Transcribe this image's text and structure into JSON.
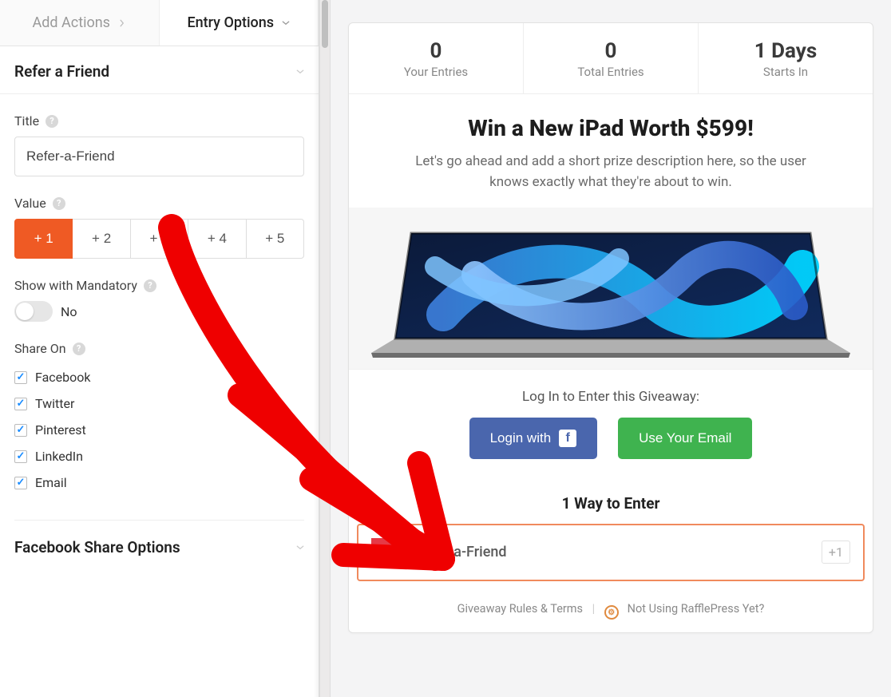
{
  "tabs": {
    "add_actions": "Add Actions",
    "entry_options": "Entry Options"
  },
  "accordion": {
    "refer_friend": "Refer a Friend",
    "facebook_share": "Facebook Share Options"
  },
  "fields": {
    "title_label": "Title",
    "title_value": "Refer-a-Friend",
    "value_label": "Value",
    "value_options": [
      "+ 1",
      "+ 2",
      "+ 3",
      "+ 4",
      "+ 5"
    ],
    "value_selected": 0,
    "mandatory_label": "Show with Mandatory",
    "mandatory_state": "No",
    "share_on_label": "Share On",
    "share_options": [
      {
        "label": "Facebook",
        "checked": true
      },
      {
        "label": "Twitter",
        "checked": true
      },
      {
        "label": "Pinterest",
        "checked": true
      },
      {
        "label": "LinkedIn",
        "checked": true
      },
      {
        "label": "Email",
        "checked": true
      }
    ]
  },
  "preview": {
    "stats": {
      "your_entries_value": "0",
      "your_entries_label": "Your Entries",
      "total_entries_value": "0",
      "total_entries_label": "Total Entries",
      "starts_in_value": "1 Days",
      "starts_in_label": "Starts In"
    },
    "hero_title": "Win a New iPad Worth $599!",
    "hero_desc": "Let's go ahead and add a short prize description here, so the user knows exactly what they're about to win.",
    "login_heading": "Log In to Enter this Giveaway:",
    "login_fb": "Login with",
    "login_email": "Use Your Email",
    "ways_header": "1 Way to Enter",
    "entry": {
      "title": "Refer-a-Friend",
      "points": "+1"
    },
    "footer": {
      "rules": "Giveaway Rules & Terms",
      "cta": "Not Using RafflePress Yet?"
    }
  }
}
